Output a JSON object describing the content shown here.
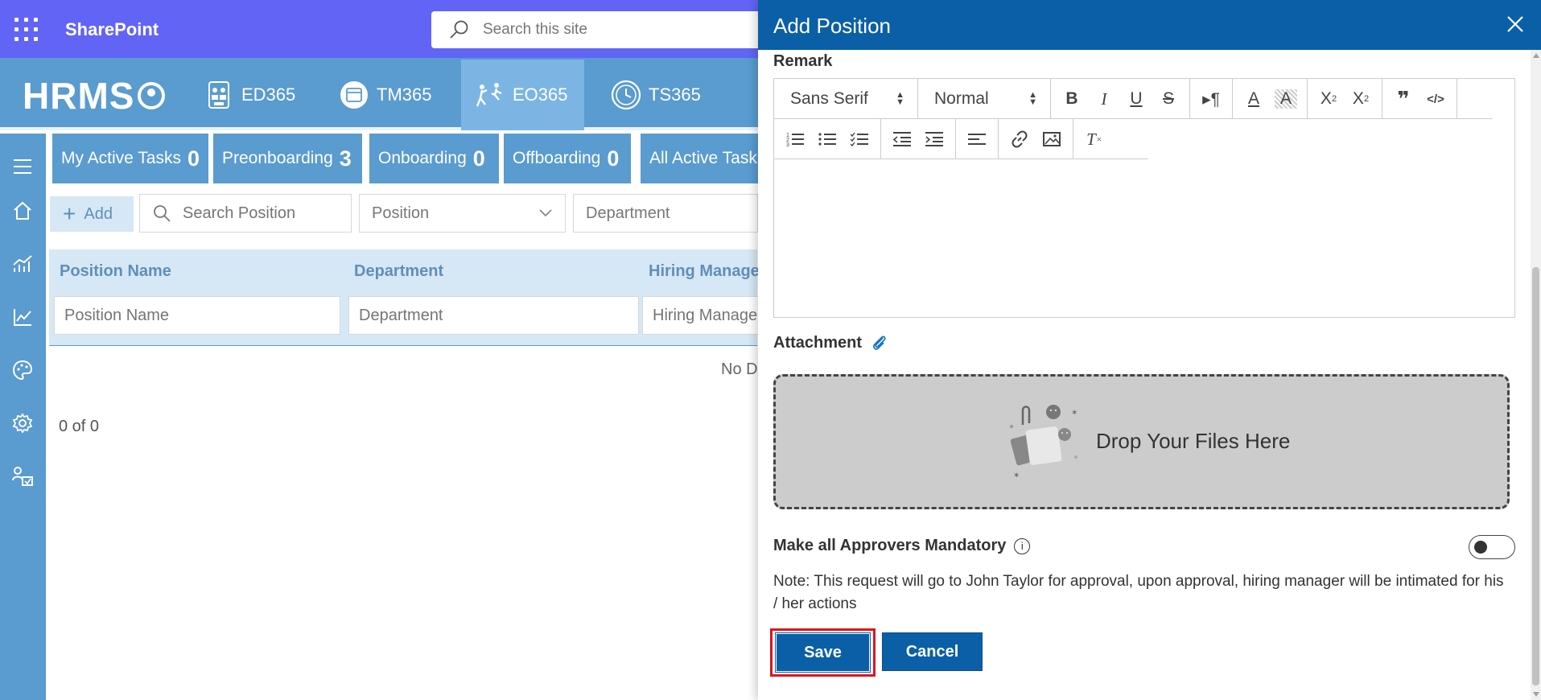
{
  "suite": {
    "app_name": "SharePoint",
    "search_placeholder": "Search this site"
  },
  "brand": {
    "logo_text": "HRMS"
  },
  "nav_tabs": [
    {
      "label": "ED365",
      "icon": "employee-directory-icon",
      "active": false
    },
    {
      "label": "TM365",
      "icon": "calendar-icon",
      "active": false
    },
    {
      "label": "EO365",
      "icon": "onboarding-icon",
      "active": true
    },
    {
      "label": "TS365",
      "icon": "clock-icon",
      "active": false
    }
  ],
  "sidebar": {
    "items": [
      {
        "name": "menu",
        "icon": "hamburger-icon"
      },
      {
        "name": "home",
        "icon": "home-icon"
      },
      {
        "name": "analytics",
        "icon": "bar-chart-icon"
      },
      {
        "name": "trends",
        "icon": "line-chart-icon"
      },
      {
        "name": "theme",
        "icon": "palette-icon"
      },
      {
        "name": "settings",
        "icon": "gear-icon"
      },
      {
        "name": "people",
        "icon": "people-icon"
      }
    ]
  },
  "task_tabs": [
    {
      "label": "My Active Tasks",
      "count": "0"
    },
    {
      "label": "Preonboarding",
      "count": "3"
    },
    {
      "label": "Onboarding",
      "count": "0"
    },
    {
      "label": "Offboarding",
      "count": "0"
    },
    {
      "label": "All Active Tasks",
      "count": ""
    }
  ],
  "toolbar": {
    "add_label": "Add",
    "search_placeholder": "Search Position",
    "position_dropdown": "Position",
    "department_dropdown": "Department"
  },
  "grid": {
    "columns": [
      "Position Name",
      "Department",
      "Hiring Manager"
    ],
    "filters": [
      "Position Name",
      "Department",
      "Hiring Manager"
    ],
    "empty_text": "No D",
    "pager": "0 of 0"
  },
  "panel": {
    "title": "Add Position",
    "remark_label": "Remark",
    "editor": {
      "font": "Sans Serif",
      "size": "Normal"
    },
    "attachment_label": "Attachment",
    "drop_text": "Drop Your Files Here",
    "approvers_label": "Make all Approvers Mandatory",
    "approvers_mandatory": false,
    "note": "Note: This request will go to John Taylor for approval, upon approval, hiring manager will be intimated for his / her actions",
    "save_label": "Save",
    "cancel_label": "Cancel"
  },
  "colors": {
    "suite_bar": "#6264f5",
    "nav_blue": "#5a9bd0",
    "panel_header": "#0a5fa7",
    "highlight": "#e0141c"
  }
}
